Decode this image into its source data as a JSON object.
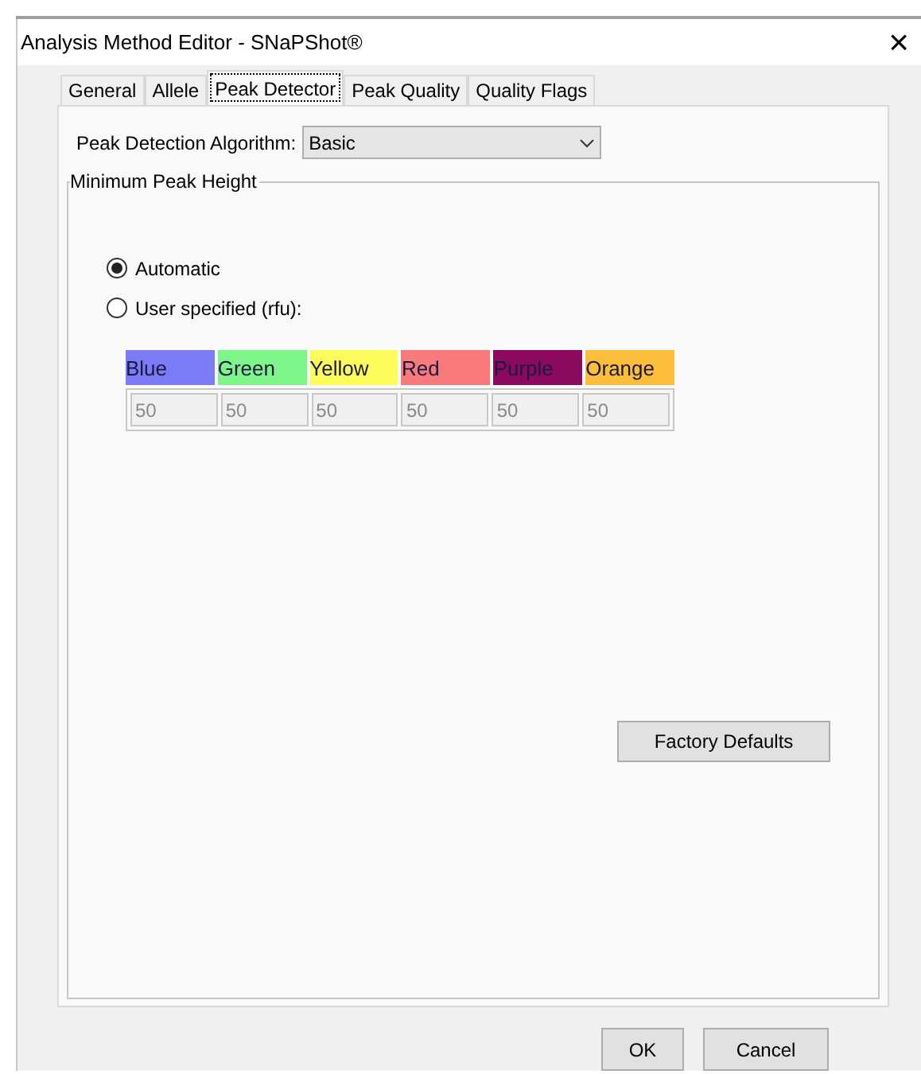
{
  "window": {
    "title": "Analysis Method Editor - SNaPShot®",
    "close": "×"
  },
  "tabs": [
    {
      "label": "General",
      "selected": false
    },
    {
      "label": "Allele",
      "selected": false
    },
    {
      "label": "Peak Detector",
      "selected": true
    },
    {
      "label": "Peak Quality",
      "selected": false
    },
    {
      "label": "Quality Flags",
      "selected": false
    }
  ],
  "algorithm": {
    "label": "Peak Detection Algorithm:",
    "value": "Basic"
  },
  "group": {
    "title": "Minimum Peak Height",
    "options": [
      {
        "label": "Automatic",
        "selected": true
      },
      {
        "label": "User specified (rfu):",
        "selected": false
      }
    ],
    "channels": [
      {
        "name": "Blue",
        "color": "#7b7bf5",
        "value": "50",
        "disabled": true
      },
      {
        "name": "Green",
        "color": "#7df58a",
        "value": "50",
        "disabled": true
      },
      {
        "name": "Yellow",
        "color": "#fbfb5a",
        "value": "50",
        "disabled": true
      },
      {
        "name": "Red",
        "color": "#f87a7a",
        "value": "50",
        "disabled": true
      },
      {
        "name": "Purple",
        "color": "#8b0a5f",
        "value": "50",
        "disabled": true
      },
      {
        "name": "Orange",
        "color": "#fbbd3a",
        "value": "50",
        "disabled": true
      }
    ]
  },
  "factory_button": "Factory Defaults",
  "buttons": [
    "OK",
    "Cancel"
  ]
}
